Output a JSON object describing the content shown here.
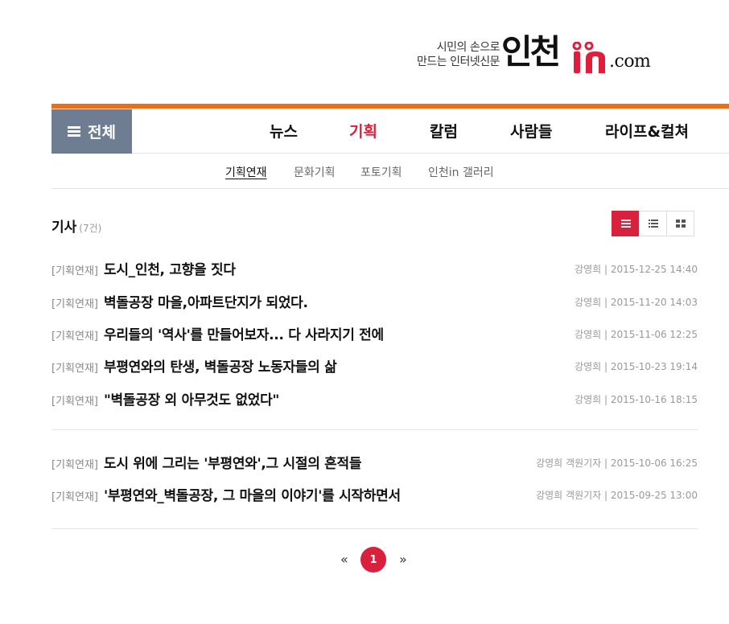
{
  "logo": {
    "tagline_line1": "시민의 손으로",
    "tagline_line2": "만드는 인터넷신문",
    "brand": "인천",
    "brand_in": "in",
    "brand_domain": ".com",
    "accent_color": "#e01e3c"
  },
  "nav": {
    "all_label": "전체",
    "items": [
      {
        "label": "뉴스",
        "active": false
      },
      {
        "label": "기획",
        "active": true
      },
      {
        "label": "칼럼",
        "active": false
      },
      {
        "label": "사람들",
        "active": false
      },
      {
        "label": "라이프&컬쳐",
        "active": false
      }
    ]
  },
  "subnav": {
    "items": [
      {
        "label": "기획연재",
        "active": true
      },
      {
        "label": "문화기획",
        "active": false
      },
      {
        "label": "포토기획",
        "active": false
      },
      {
        "label": "인천in 갤러리",
        "active": false
      }
    ]
  },
  "section": {
    "title": "기사",
    "count": "(7건)"
  },
  "view_toggle": [
    {
      "icon": "list-view-icon",
      "active": true
    },
    {
      "icon": "compact-list-icon",
      "active": false
    },
    {
      "icon": "grid-view-icon",
      "active": false
    }
  ],
  "articles": [
    {
      "category": "[기획연재]",
      "title": "도시_인천, 고향을 짓다",
      "meta": "강영희 | 2015-12-25 14:40"
    },
    {
      "category": "[기획연재]",
      "title": "벽돌공장 마을,아파트단지가 되었다.",
      "meta": "강영희 | 2015-11-20 14:03"
    },
    {
      "category": "[기획연재]",
      "title": "우리들의 '역사'를 만들어보자... 다 사라지기 전에",
      "meta": "강영희 | 2015-11-06 12:25"
    },
    {
      "category": "[기획연재]",
      "title": "부평연와의 탄생, 벽돌공장 노동자들의 삶",
      "meta": "강영희 | 2015-10-23 19:14"
    },
    {
      "category": "[기획연재]",
      "title": "\"벽돌공장 외 아무것도 없었다\"",
      "meta": "강영희 | 2015-10-16 18:15"
    },
    {
      "category": "[기획연재]",
      "title": "도시 위에 그리는 '부평연와',그 시절의 흔적들",
      "meta": "강영희 객원기자 | 2015-10-06 16:25"
    },
    {
      "category": "[기획연재]",
      "title": "'부평연와_벽돌공장, 그 마을의 이야기'를 시작하면서",
      "meta": "강영희 객원기자 | 2015-09-25 13:00"
    }
  ],
  "pagination": {
    "prev": "«",
    "current": "1",
    "next": "»"
  },
  "colors": {
    "accent_red": "#d9203c",
    "top_bar_orange": "#ee6e17",
    "all_button_bg": "#6e7d92"
  }
}
